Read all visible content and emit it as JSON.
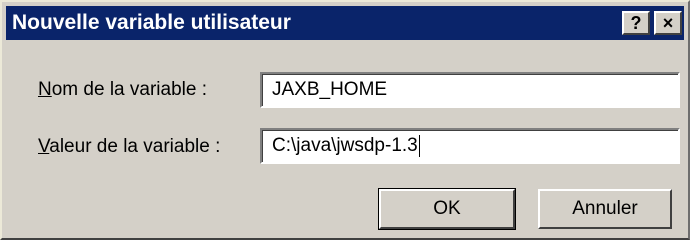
{
  "window": {
    "title": "Nouvelle variable utilisateur",
    "help_button": "?",
    "close_button": "×"
  },
  "form": {
    "name_label_accel": "N",
    "name_label_rest": "om de la variable :",
    "name_value": "JAXB_HOME",
    "value_label_accel": "V",
    "value_label_rest": "aleur de la variable :",
    "value_value": "C:\\java\\jwsdp-1.3"
  },
  "buttons": {
    "ok": "OK",
    "cancel": "Annuler"
  },
  "colors": {
    "titlebar": "#0a246a",
    "face": "#d4d0c8"
  }
}
